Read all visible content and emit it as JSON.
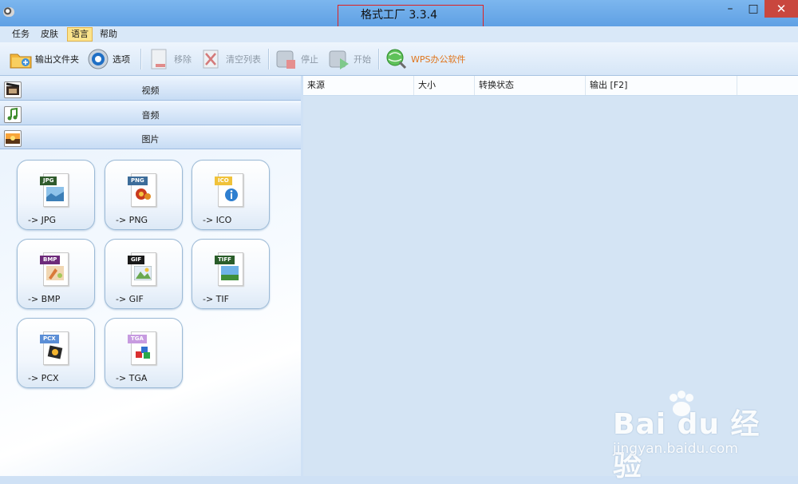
{
  "window": {
    "title": "格式工厂 3.3.4",
    "minimize": "–",
    "maximize": "□",
    "close": "✕"
  },
  "menu": [
    "任务",
    "皮肤",
    "语言",
    "帮助"
  ],
  "menu_active_index": 2,
  "toolbar": {
    "output_folder": "输出文件夹",
    "options": "选项",
    "remove": "移除",
    "clear_list": "清空列表",
    "stop": "停止",
    "start": "开始",
    "wps": "WPS办公软件"
  },
  "categories": {
    "video": "视频",
    "audio": "音频",
    "image": "图片"
  },
  "image_tiles": [
    {
      "tag": "JPG",
      "label": "-> JPG",
      "tag_color": "#2f5b2c"
    },
    {
      "tag": "PNG",
      "label": "-> PNG",
      "tag_color": "#3d6d9a"
    },
    {
      "tag": "ICO",
      "label": "-> ICO",
      "tag_color": "#f0c23a"
    },
    {
      "tag": "BMP",
      "label": "-> BMP",
      "tag_color": "#6d2a7a"
    },
    {
      "tag": "GIF",
      "label": "-> GIF",
      "tag_color": "#1a1a1a"
    },
    {
      "tag": "TIFF",
      "label": "-> TIF",
      "tag_color": "#2a5d2a"
    },
    {
      "tag": "PCX",
      "label": "-> PCX",
      "tag_color": "#5b8ed6"
    },
    {
      "tag": "TGA",
      "label": "-> TGA",
      "tag_color": "#c79be0"
    }
  ],
  "list_columns": [
    "来源",
    "大小",
    "转换状态",
    "输出 [F2]"
  ],
  "watermark": {
    "brand": "Bai du 经验",
    "url": "jingyan.baidu.com"
  },
  "colors": {
    "title_bar": "#6aa8e8",
    "close_button": "#c9473e",
    "active_menu": "#fbe38c",
    "wps_text": "#e0751c",
    "right_pane": "#d4e4f4"
  }
}
